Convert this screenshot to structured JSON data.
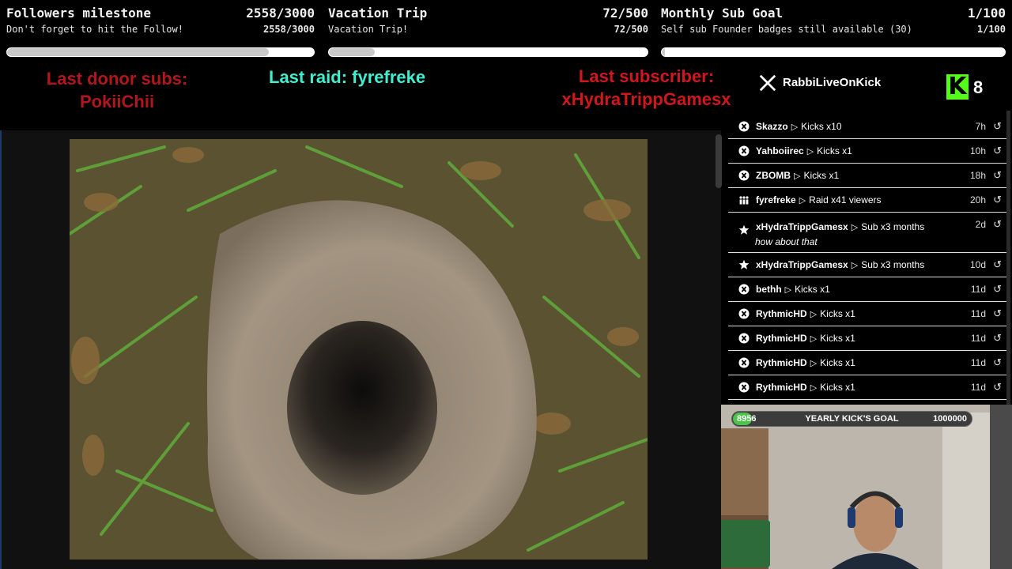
{
  "goals": [
    {
      "title": "Followers milestone",
      "count": "2558/3000",
      "subtitle": "Don't forget to hit the Follow!",
      "subcount": "2558/3000",
      "progress": 0.853
    },
    {
      "title": "Vacation Trip",
      "count": "72/500",
      "subtitle": "Vacation Trip!",
      "subcount": "72/500",
      "progress": 0.144
    },
    {
      "title": "Monthly Sub Goal",
      "count": "1/100",
      "subtitle": "Self sub Founder badges still available (30)",
      "subcount": "1/100",
      "progress": 0.01
    }
  ],
  "alerts": {
    "donor_label": "Last donor subs:",
    "donor_name": "PokiiChii",
    "raid": "Last raid: fyrefreke",
    "subscriber_label": "Last subscriber:",
    "subscriber_name": "xHydraTrippGamesx"
  },
  "header": {
    "x_icon": "x-logo-icon",
    "channel": "RabbiLiveOnKick",
    "kick_logo_letter": "K",
    "viewers": "8"
  },
  "feed": [
    {
      "icon": "kick-icon",
      "user": "Skazzo",
      "action": "Kicks x10",
      "time": "7h"
    },
    {
      "icon": "kick-icon",
      "user": "Yahboiirec",
      "action": "Kicks x1",
      "time": "10h"
    },
    {
      "icon": "kick-icon",
      "user": "ZBOMB",
      "action": "Kicks x1",
      "time": "18h"
    },
    {
      "icon": "raid-icon",
      "user": "fyrefreke",
      "action": "Raid x41 viewers",
      "time": "20h"
    },
    {
      "icon": "star-icon",
      "user": "xHydraTrippGamesx",
      "action": "Sub x3 months",
      "time": "2d",
      "message": "how about that"
    },
    {
      "icon": "star-icon",
      "user": "xHydraTrippGamesx",
      "action": "Sub x3 months",
      "time": "10d"
    },
    {
      "icon": "kick-icon",
      "user": "bethh",
      "action": "Kicks x1",
      "time": "11d"
    },
    {
      "icon": "kick-icon",
      "user": "RythmicHD",
      "action": "Kicks x1",
      "time": "11d"
    },
    {
      "icon": "kick-icon",
      "user": "RythmicHD",
      "action": "Kicks x1",
      "time": "11d"
    },
    {
      "icon": "kick-icon",
      "user": "RythmicHD",
      "action": "Kicks x1",
      "time": "11d"
    },
    {
      "icon": "kick-icon",
      "user": "RythmicHD",
      "action": "Kicks x1",
      "time": "11d"
    }
  ],
  "kick_goal": {
    "current": "8956",
    "label": "YEARLY KICK'S GOAL",
    "target": "1000000",
    "progress": 0.009
  },
  "colors": {
    "kick_green": "#53fc18",
    "raid_cyan": "#3ff0d0",
    "alert_red": "#d0181c"
  }
}
